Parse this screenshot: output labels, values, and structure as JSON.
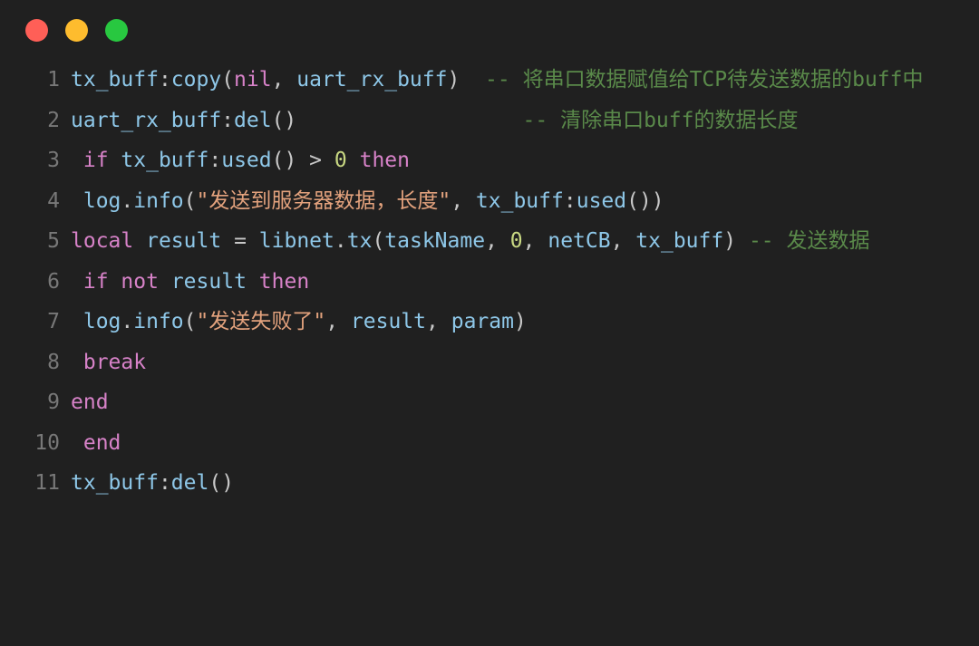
{
  "window": {
    "controls": [
      {
        "name": "close",
        "color": "#ff5f57",
        "label": "close"
      },
      {
        "name": "minimize",
        "color": "#febc2e",
        "label": "minimize"
      },
      {
        "name": "maximize",
        "color": "#28c840",
        "label": "maximize"
      }
    ]
  },
  "editor": {
    "language": "lua",
    "background": "#202020",
    "gutter_color": "#787878",
    "colors": {
      "identifier": "#8ec7e8",
      "keyword": "#d782c8",
      "string": "#e3a27d",
      "number": "#c8d882",
      "comment": "#5a8a4a",
      "punctuation": "#c8c8c8"
    },
    "lines": [
      {
        "number": "1",
        "text": "tx_buff:copy(nil, uart_rx_buff)  -- 将串口数据赋值给TCP待发送数据的buff中",
        "tokens": [
          {
            "t": "tx_buff",
            "c": "ident"
          },
          {
            "t": ":",
            "c": "punc"
          },
          {
            "t": "copy",
            "c": "fn"
          },
          {
            "t": "(",
            "c": "punc"
          },
          {
            "t": "nil",
            "c": "nil"
          },
          {
            "t": ", ",
            "c": "punc"
          },
          {
            "t": "uart_rx_buff",
            "c": "ident"
          },
          {
            "t": ")",
            "c": "punc"
          },
          {
            "t": "  ",
            "c": "punc"
          },
          {
            "t": "-- 将串口数据赋值给TCP待发送数据的buff中",
            "c": "comment"
          }
        ]
      },
      {
        "number": "2",
        "text": "uart_rx_buff:del()                  -- 清除串口buff的数据长度",
        "tokens": [
          {
            "t": "uart_rx_buff",
            "c": "ident"
          },
          {
            "t": ":",
            "c": "punc"
          },
          {
            "t": "del",
            "c": "fn"
          },
          {
            "t": "()",
            "c": "punc"
          },
          {
            "t": "                  ",
            "c": "punc"
          },
          {
            "t": "-- 清除串口buff的数据长度",
            "c": "comment"
          }
        ]
      },
      {
        "number": "3",
        "text": " if tx_buff:used() > 0 then",
        "tokens": [
          {
            "t": " ",
            "c": "punc"
          },
          {
            "t": "if",
            "c": "kw"
          },
          {
            "t": " ",
            "c": "punc"
          },
          {
            "t": "tx_buff",
            "c": "ident"
          },
          {
            "t": ":",
            "c": "punc"
          },
          {
            "t": "used",
            "c": "fn"
          },
          {
            "t": "() ",
            "c": "punc"
          },
          {
            "t": ">",
            "c": "op"
          },
          {
            "t": " ",
            "c": "punc"
          },
          {
            "t": "0",
            "c": "num"
          },
          {
            "t": " ",
            "c": "punc"
          },
          {
            "t": "then",
            "c": "kw"
          }
        ]
      },
      {
        "number": "4",
        "text": " log.info(\"发送到服务器数据，长度\", tx_buff:used())",
        "tokens": [
          {
            "t": " ",
            "c": "punc"
          },
          {
            "t": "log",
            "c": "ident"
          },
          {
            "t": ".",
            "c": "punc"
          },
          {
            "t": "info",
            "c": "fn"
          },
          {
            "t": "(",
            "c": "punc"
          },
          {
            "t": "\"发送到服务器数据，长度\"",
            "c": "str"
          },
          {
            "t": ", ",
            "c": "punc"
          },
          {
            "t": "tx_buff",
            "c": "ident"
          },
          {
            "t": ":",
            "c": "punc"
          },
          {
            "t": "used",
            "c": "fn"
          },
          {
            "t": "())",
            "c": "punc"
          }
        ]
      },
      {
        "number": "5",
        "text": "local result = libnet.tx(taskName, 0, netCB, tx_buff) -- 发送数据",
        "tokens": [
          {
            "t": "local",
            "c": "kw"
          },
          {
            "t": " ",
            "c": "punc"
          },
          {
            "t": "result",
            "c": "ident"
          },
          {
            "t": " ",
            "c": "punc"
          },
          {
            "t": "=",
            "c": "op"
          },
          {
            "t": " ",
            "c": "punc"
          },
          {
            "t": "libnet",
            "c": "ident"
          },
          {
            "t": ".",
            "c": "punc"
          },
          {
            "t": "tx",
            "c": "fn"
          },
          {
            "t": "(",
            "c": "punc"
          },
          {
            "t": "taskName",
            "c": "ident"
          },
          {
            "t": ", ",
            "c": "punc"
          },
          {
            "t": "0",
            "c": "num"
          },
          {
            "t": ", ",
            "c": "punc"
          },
          {
            "t": "netCB",
            "c": "ident"
          },
          {
            "t": ", ",
            "c": "punc"
          },
          {
            "t": "tx_buff",
            "c": "ident"
          },
          {
            "t": ")",
            "c": "punc"
          },
          {
            "t": " ",
            "c": "punc"
          },
          {
            "t": "-- 发送数据",
            "c": "comment"
          }
        ]
      },
      {
        "number": "6",
        "text": " if not result then",
        "tokens": [
          {
            "t": " ",
            "c": "punc"
          },
          {
            "t": "if",
            "c": "kw"
          },
          {
            "t": " ",
            "c": "punc"
          },
          {
            "t": "not",
            "c": "kw"
          },
          {
            "t": " ",
            "c": "punc"
          },
          {
            "t": "result",
            "c": "ident"
          },
          {
            "t": " ",
            "c": "punc"
          },
          {
            "t": "then",
            "c": "kw"
          }
        ]
      },
      {
        "number": "7",
        "text": " log.info(\"发送失败了\", result, param)",
        "tokens": [
          {
            "t": " ",
            "c": "punc"
          },
          {
            "t": "log",
            "c": "ident"
          },
          {
            "t": ".",
            "c": "punc"
          },
          {
            "t": "info",
            "c": "fn"
          },
          {
            "t": "(",
            "c": "punc"
          },
          {
            "t": "\"发送失败了\"",
            "c": "str"
          },
          {
            "t": ", ",
            "c": "punc"
          },
          {
            "t": "result",
            "c": "ident"
          },
          {
            "t": ", ",
            "c": "punc"
          },
          {
            "t": "param",
            "c": "ident"
          },
          {
            "t": ")",
            "c": "punc"
          }
        ]
      },
      {
        "number": "8",
        "text": " break",
        "tokens": [
          {
            "t": " ",
            "c": "punc"
          },
          {
            "t": "break",
            "c": "kw"
          }
        ]
      },
      {
        "number": "9",
        "text": "end",
        "tokens": [
          {
            "t": "end",
            "c": "kw"
          }
        ]
      },
      {
        "number": "10",
        "text": " end",
        "tokens": [
          {
            "t": " ",
            "c": "punc"
          },
          {
            "t": "end",
            "c": "kw"
          }
        ]
      },
      {
        "number": "11",
        "text": "tx_buff:del()",
        "tokens": [
          {
            "t": "tx_buff",
            "c": "ident"
          },
          {
            "t": ":",
            "c": "punc"
          },
          {
            "t": "del",
            "c": "fn"
          },
          {
            "t": "()",
            "c": "punc"
          }
        ]
      }
    ]
  }
}
